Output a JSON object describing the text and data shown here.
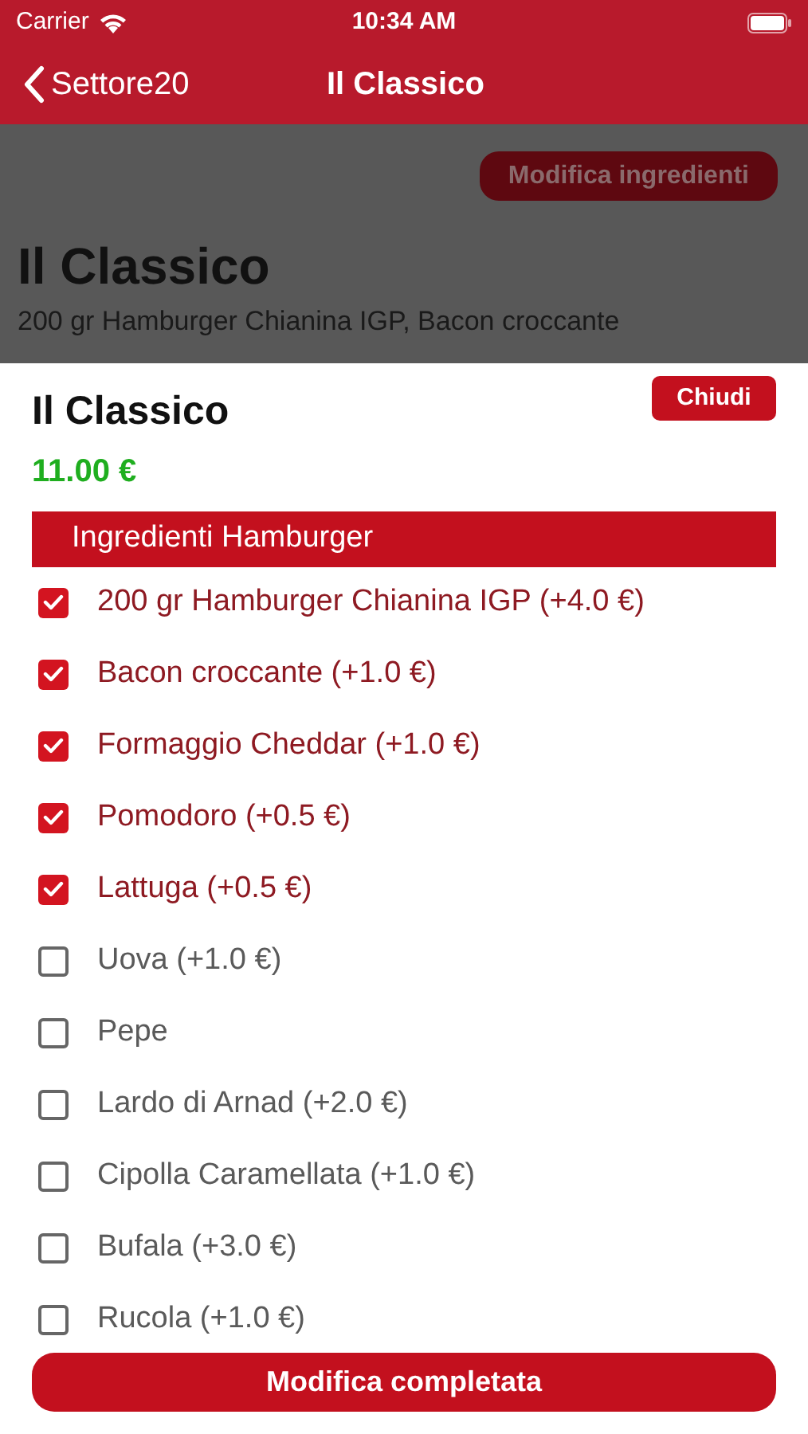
{
  "status_bar": {
    "carrier": "Carrier",
    "time": "10:34 AM"
  },
  "nav": {
    "back": "Settore20",
    "title": "Il Classico"
  },
  "background": {
    "button": "Modifica ingredienti",
    "title": "Il Classico",
    "description": "200 gr Hamburger Chianina IGP, Bacon croccante"
  },
  "sheet": {
    "title": "Il Classico",
    "close": "Chiudi",
    "price": "11.00 €",
    "section": "Ingredienti Hamburger",
    "ingredients": [
      {
        "label": "200 gr Hamburger Chianina IGP (+4.0 €)",
        "checked": true
      },
      {
        "label": "Bacon croccante (+1.0 €)",
        "checked": true
      },
      {
        "label": "Formaggio Cheddar (+1.0 €)",
        "checked": true
      },
      {
        "label": "Pomodoro (+0.5 €)",
        "checked": true
      },
      {
        "label": "Lattuga (+0.5 €)",
        "checked": true
      },
      {
        "label": "Uova (+1.0 €)",
        "checked": false
      },
      {
        "label": "Pepe",
        "checked": false
      },
      {
        "label": "Lardo di Arnad (+2.0 €)",
        "checked": false
      },
      {
        "label": "Cipolla Caramellata (+1.0 €)",
        "checked": false
      },
      {
        "label": "Bufala (+3.0 €)",
        "checked": false
      },
      {
        "label": "Rucola (+1.0 €)",
        "checked": false
      }
    ],
    "confirm": "Modifica completata"
  }
}
